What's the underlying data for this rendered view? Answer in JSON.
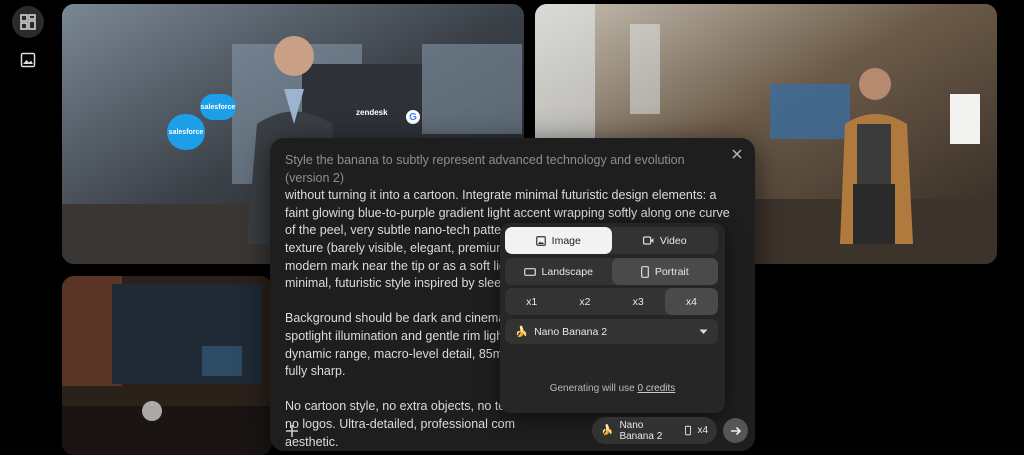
{
  "sidebar": {
    "items": [
      {
        "icon": "grid-layout-icon",
        "active": true
      },
      {
        "icon": "image-icon",
        "active": false
      }
    ]
  },
  "gallery": {
    "tile1": {
      "salesforce_label_1": "salesforce",
      "salesforce_label_2": "salesforce",
      "zendesk_label": "zendesk"
    },
    "tile2": {},
    "tile3": {}
  },
  "prompt_panel": {
    "paragraph1_faded": "Style the banana to subtly represent advanced technology and evolution (version 2)",
    "paragraph1": "without turning it into a cartoon. Integrate minimal futuristic design elements: a faint glowing blue-to-purple gradient light accent wrapping softly along one curve of the peel, very subtle nano-tech pattern lines embedded into the surface texture (barely visible, elegant, premium). The number “2”\nmodern mark near the tip or as a soft light\nminimal, futuristic style inspired by sleek t",
    "paragraph2": "Background should be dark and cinematic\nspotlight illumination and gentle rim light h\ndynamic range, macro-level detail, 85mm\nfully sharp.",
    "paragraph3": "No cartoon style, no extra objects, no text\nno logos. Ultra-detailed, professional com\naesthetic."
  },
  "settings_menu": {
    "media_type": {
      "options": [
        "Image",
        "Video"
      ],
      "selected": "Image"
    },
    "orientation": {
      "options": [
        "Landscape",
        "Portrait"
      ],
      "selected": "Portrait"
    },
    "count": {
      "options": [
        "x1",
        "x2",
        "x3",
        "x4"
      ],
      "selected": "x4"
    },
    "model": {
      "emoji": "🍌",
      "name": "Nano Banana 2"
    },
    "credits_prefix": "Generating will use ",
    "credits_link": "0 credits"
  },
  "composer": {
    "chip_emoji": "🍌",
    "chip_model": "Nano Banana 2",
    "chip_count": "x4"
  },
  "colors": {
    "background": "#000000",
    "panel": "#1e1e1e",
    "menu": "#262626",
    "accent_glow": "#6a3cff"
  }
}
